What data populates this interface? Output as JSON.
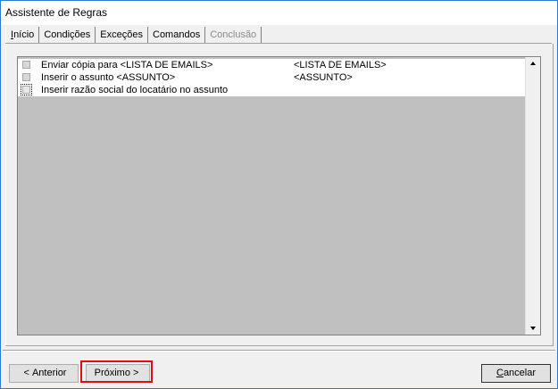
{
  "window": {
    "title": "Assistente de Regras"
  },
  "tabs": [
    {
      "label": "Início",
      "ul": "I",
      "rest": "nício",
      "state": "normal"
    },
    {
      "label": "Condições",
      "ul": "",
      "rest": "Condições",
      "state": "normal"
    },
    {
      "label": "Exceções",
      "ul": "",
      "rest": "Exceções",
      "state": "normal"
    },
    {
      "label": "Comandos",
      "ul": "",
      "rest": "Comandos",
      "state": "active"
    },
    {
      "label": "Conclusão",
      "ul": "",
      "rest": "Conclusão",
      "state": "disabled"
    }
  ],
  "commands": [
    {
      "label": "Enviar cópia para <LISTA DE EMAILS>",
      "value": "<LISTA DE EMAILS>"
    },
    {
      "label": "Inserir o assunto <ASSUNTO>",
      "value": "<ASSUNTO>"
    },
    {
      "label": "Inserir razão social do locatário no assunto",
      "value": ""
    }
  ],
  "buttons": {
    "prev": {
      "chevron": "<",
      "label": "Anterior"
    },
    "next": {
      "label": "Próximo",
      "chevron": ">"
    },
    "cancel": {
      "ul": "C",
      "rest": "ancelar"
    }
  },
  "colors": {
    "highlight": "#e01010",
    "accent_border": "#2b7bd6"
  }
}
